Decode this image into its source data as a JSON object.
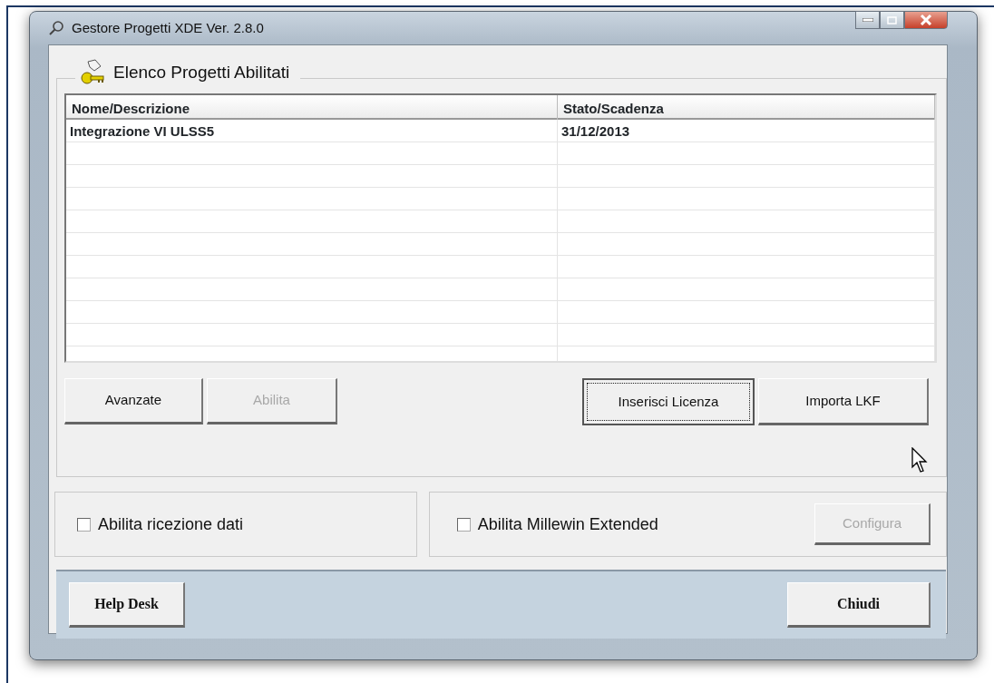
{
  "window": {
    "title": "Gestore Progetti XDE Ver. 2.8.0"
  },
  "group": {
    "title": "Elenco Progetti Abilitati"
  },
  "table": {
    "columns": [
      "Nome/Descrizione",
      "Stato/Scadenza"
    ],
    "rows": [
      {
        "cells": [
          "Integrazione VI ULSS5",
          "31/12/2013"
        ],
        "selected": false
      }
    ]
  },
  "left_buttons": [
    {
      "label": "Avanzate",
      "disabled": false,
      "focused": false
    },
    {
      "label": "Abilita",
      "disabled": true,
      "focused": false
    }
  ],
  "right_buttons": [
    {
      "label": "Inserisci Licenza",
      "disabled": false,
      "focused": true
    },
    {
      "label": "Importa LKF",
      "disabled": false,
      "focused": false
    }
  ],
  "options": [
    {
      "label": "Abilita ricezione dati",
      "checked": false
    },
    {
      "label": "Abilita Millewin Extended",
      "checked": false,
      "button": {
        "label": "Configura",
        "disabled": true
      }
    }
  ],
  "footer_buttons": [
    {
      "label": "Help Desk"
    },
    {
      "label": "Chiudi"
    }
  ]
}
